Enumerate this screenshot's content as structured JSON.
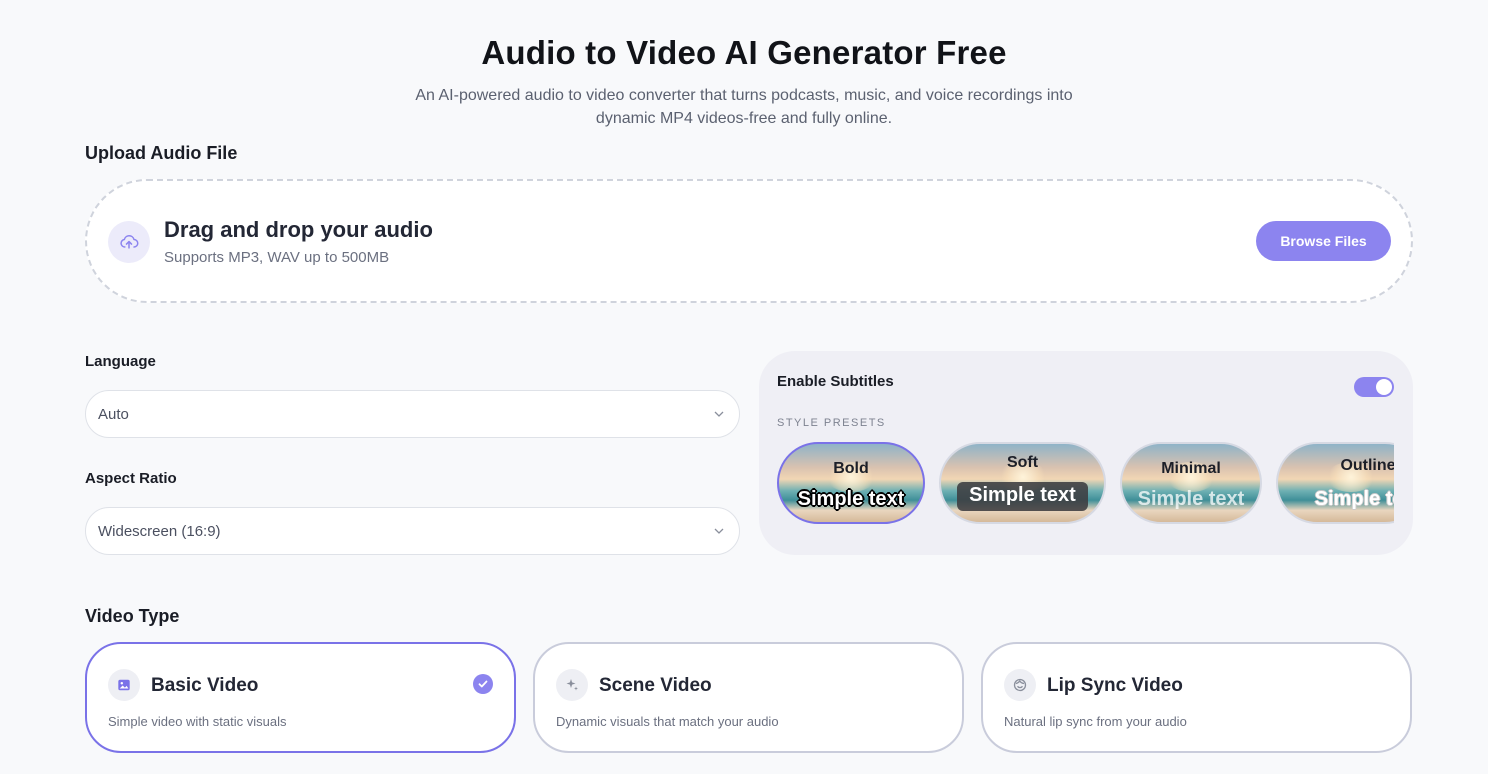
{
  "header": {
    "title": "Audio to Video AI Generator Free",
    "subtitle_line1": "An AI-powered audio to video converter that turns podcasts, music, and voice recordings into",
    "subtitle_line2": "dynamic MP4 videos-free and fully online."
  },
  "upload": {
    "section_label": "Upload Audio File",
    "title": "Drag and drop your audio",
    "hint": "Supports MP3, WAV up to 500MB",
    "browse_label": "Browse Files",
    "icon": "cloud-upload-icon"
  },
  "settings": {
    "language_label": "Language",
    "language_value": "Auto",
    "aspect_label": "Aspect Ratio",
    "aspect_value": "Widescreen (16:9)"
  },
  "subtitles": {
    "title": "Enable Subtitles",
    "enabled": true,
    "presets_label": "STYLE PRESETS",
    "presets": [
      {
        "name": "Bold",
        "sample": "Simple text",
        "selected": true
      },
      {
        "name": "Soft",
        "sample": "Simple text",
        "selected": false
      },
      {
        "name": "Minimal",
        "sample": "Simple text",
        "selected": false
      },
      {
        "name": "Outline",
        "sample": "Simple text",
        "selected": false
      }
    ]
  },
  "video_type": {
    "section_label": "Video Type",
    "options": [
      {
        "title": "Basic Video",
        "desc": "Simple video with static visuals",
        "icon": "image-icon",
        "selected": true
      },
      {
        "title": "Scene Video",
        "desc": "Dynamic visuals that match your audio",
        "icon": "sparkle-icon",
        "selected": false
      },
      {
        "title": "Lip Sync Video",
        "desc": "Natural lip sync from your audio",
        "icon": "face-icon",
        "selected": false
      }
    ]
  },
  "colors": {
    "accent": "#8c84ef",
    "accent_border": "#7a72e8",
    "background": "#f8f9fb"
  }
}
